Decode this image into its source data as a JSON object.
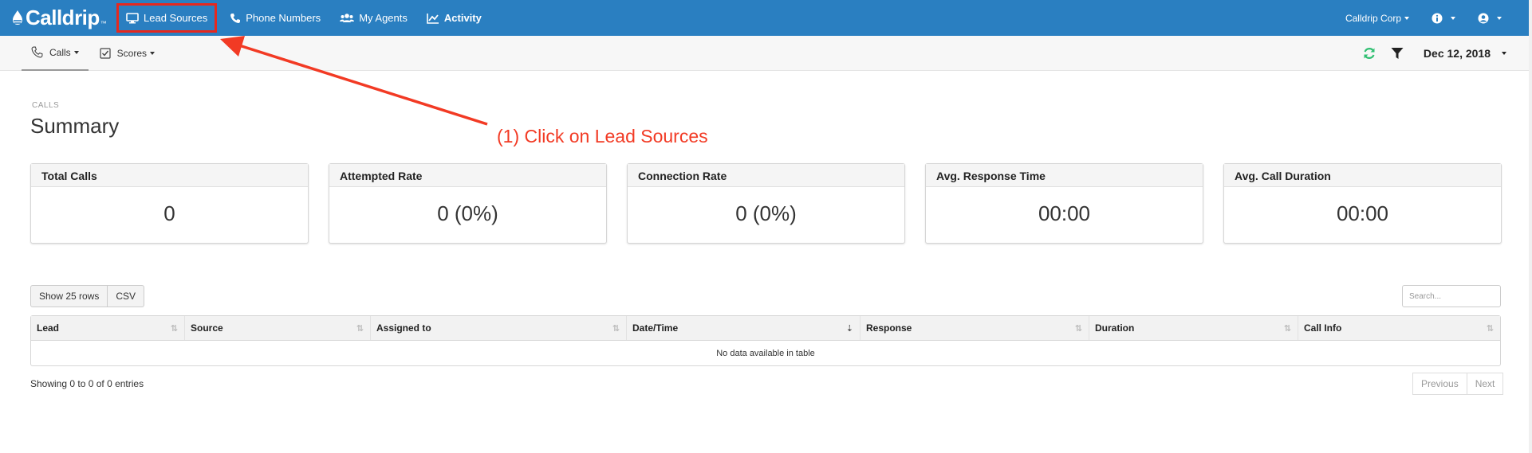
{
  "brand": {
    "name": "Calldrip",
    "tm": "™"
  },
  "topnav": {
    "items": [
      {
        "label": "Lead Sources"
      },
      {
        "label": "Phone Numbers"
      },
      {
        "label": "My Agents"
      },
      {
        "label": "Activity"
      }
    ],
    "account": "Calldrip Corp"
  },
  "subnav": {
    "tabs": [
      {
        "label": "Calls"
      },
      {
        "label": "Scores"
      }
    ],
    "date": "Dec 12, 2018"
  },
  "page": {
    "breadcrumb": "CALLS",
    "title": "Summary"
  },
  "annotation": "(1) Click on Lead Sources",
  "cards": [
    {
      "title": "Total Calls",
      "value": "0"
    },
    {
      "title": "Attempted Rate",
      "value": "0 (0%)"
    },
    {
      "title": "Connection Rate",
      "value": "0 (0%)"
    },
    {
      "title": "Avg. Response Time",
      "value": "00:00"
    },
    {
      "title": "Avg. Call Duration",
      "value": "00:00"
    }
  ],
  "table": {
    "show_rows_label": "Show 25 rows",
    "csv_label": "CSV",
    "search_placeholder": "Search...",
    "columns": [
      "Lead",
      "Source",
      "Assigned to",
      "Date/Time",
      "Response",
      "Duration",
      "Call Info"
    ],
    "empty_message": "No data available in table",
    "info": "Showing 0 to 0 of 0 entries",
    "prev_label": "Previous",
    "next_label": "Next"
  },
  "colors": {
    "nav": "#2a7fc1",
    "annotation": "#f23a24",
    "refresh": "#2fbf71"
  }
}
